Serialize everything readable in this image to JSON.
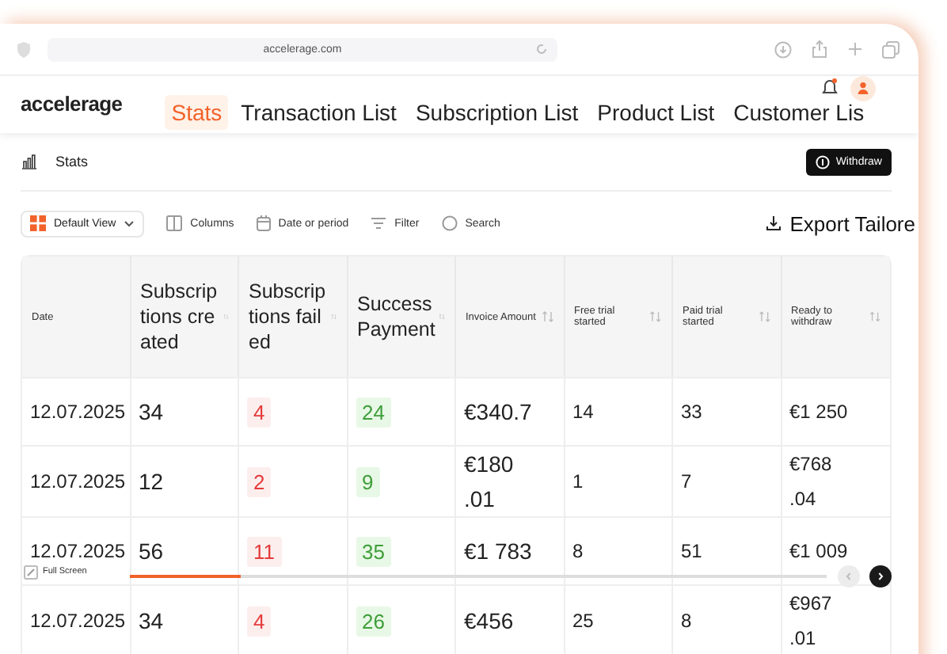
{
  "browser": {
    "url": "accelerage.com"
  },
  "header": {
    "logo": "accelerage",
    "tabs": [
      {
        "label": "Stats",
        "selected": true
      },
      {
        "label": "Transaction List",
        "selected": false
      },
      {
        "label": "Subscription List",
        "selected": false
      },
      {
        "label": "Product List",
        "selected": false
      },
      {
        "label": "Customer Lis",
        "selected": false
      }
    ]
  },
  "page": {
    "title": "Stats",
    "withdraw_button": "Withdraw"
  },
  "toolbar": {
    "view": "Default View",
    "items": [
      {
        "kind": "columns",
        "label": "Columns"
      },
      {
        "kind": "date",
        "label": "Date or period"
      },
      {
        "kind": "filter",
        "label": "Filter"
      },
      {
        "kind": "search",
        "label": "Search"
      }
    ],
    "export": "Export Tailore"
  },
  "table": {
    "columns": [
      {
        "label": "Date",
        "kind": "date"
      },
      {
        "label": "Subscriptions created",
        "kind": "count"
      },
      {
        "label": "Subscriptions failed",
        "kind": "failed"
      },
      {
        "label": "Success Payment",
        "kind": "success"
      },
      {
        "label": "Invoice Amount",
        "kind": "amount"
      },
      {
        "label": "Free trial started",
        "kind": "small"
      },
      {
        "label": "Paid trial started",
        "kind": "small"
      },
      {
        "label": "Ready to withdraw",
        "kind": "small"
      }
    ],
    "rows": [
      [
        "12.07.2025",
        "34",
        "4",
        "24",
        "€340.7",
        "14",
        "33",
        "€1 250"
      ],
      [
        "12.07.2025",
        "12",
        "2",
        "9",
        "€180 .01",
        "1",
        "7",
        "€768 .04"
      ],
      [
        "12.07.2025",
        "56",
        "11",
        "35",
        "€1 783",
        "8",
        "51",
        "€1 009"
      ],
      [
        "12.07.2025",
        "34",
        "4",
        "26",
        "€456",
        "25",
        "8",
        "€967 .01"
      ]
    ]
  },
  "overlay": {
    "label": "Full Screen",
    "level": 0.16
  }
}
